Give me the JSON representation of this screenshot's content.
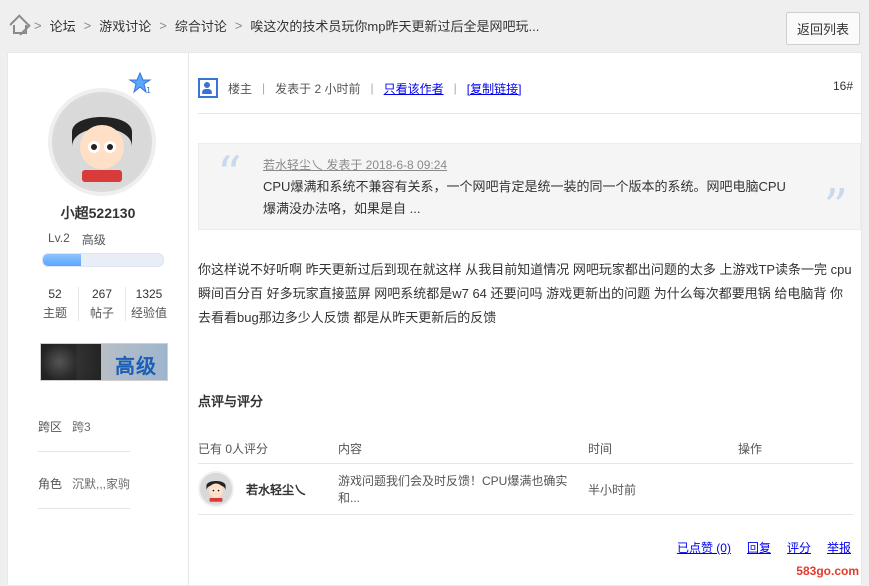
{
  "breadcrumb": {
    "items": [
      "论坛",
      "游戏讨论",
      "综合讨论",
      "唉这次的技术员玩你mp昨天更新过后全是网吧玩..."
    ]
  },
  "header": {
    "back_label": "返回列表"
  },
  "sidebar": {
    "badge_number": "1",
    "username": "小超522130",
    "level": "Lv.2",
    "level_title": "高级",
    "progress": 0.32,
    "stats": [
      {
        "num": "52",
        "label": "主题"
      },
      {
        "num": "267",
        "label": "帖子"
      },
      {
        "num": "1325",
        "label": "经验值"
      }
    ],
    "medal_text": "高级",
    "meta": [
      {
        "label": "跨区",
        "value": "跨3"
      },
      {
        "label": "角色",
        "value": "沉默,,,家驹"
      }
    ]
  },
  "post": {
    "owner_label": "楼主",
    "posted_time": "发表于 2 小时前",
    "only_author": "只看该作者",
    "copy_link": "[复制链接]",
    "floor": "16#",
    "quote_author": "若水轻尘乀 发表于 2018-6-8 09:24",
    "quote_text": "CPU爆满和系统不兼容有关系，一个网吧肯定是统一装的同一个版本的系统。网吧电脑CPU爆满没办法咯，如果是自 ...",
    "body": "你这样说不好听啊 昨天更新过后到现在就这样 从我目前知道情况 网吧玩家都出问题的太多 上游戏TP读条一完 cpu瞬间百分百 好多玩家直接蓝屏  网吧系统都是w7  64  还要问吗  游戏更新出的问题 为什么每次都要甩锅 给电脑背 你去看看bug那边多少人反馈 都是从昨天更新后的反馈"
  },
  "ratings": {
    "title": "点评与评分",
    "headers": {
      "count": "已有 0人评分",
      "content": "内容",
      "time": "时间",
      "action": "操作"
    },
    "rows": [
      {
        "name": "若水轻尘乀",
        "content": "游戏问题我们会及时反馈！CPU爆满也确实和...",
        "time": "半小时前"
      }
    ]
  },
  "actions": {
    "likes": "已点赞 (0)",
    "reply": "回复",
    "rate": "评分",
    "report": "举报"
  },
  "watermark": "583go.com"
}
